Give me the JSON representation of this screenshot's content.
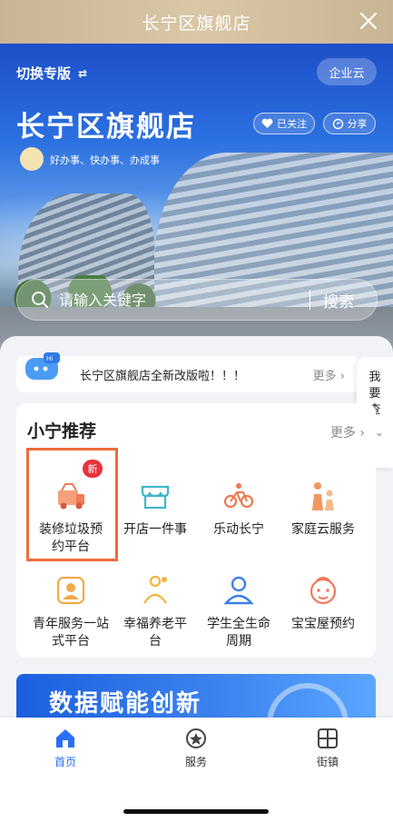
{
  "titlebar": {
    "title": "长宁区旗舰店"
  },
  "hero": {
    "switch_label": "切换专版",
    "enterprise_label": "企业云",
    "store_name": "长宁区旗舰店",
    "followed_label": "已关注",
    "share_label": "分享",
    "slogan": "好办事、快办事、办成事"
  },
  "search": {
    "placeholder": "请输入关键字",
    "button_label": "搜索"
  },
  "notice": {
    "text": "长宁区旗舰店全新改版啦！！！",
    "more_label": "更多",
    "hi_label": "Hi"
  },
  "side_tab": {
    "label": "我要查"
  },
  "recommend": {
    "title": "小宁推荐",
    "more_label": "更多",
    "new_badge": "新",
    "items": [
      {
        "label": "装修垃圾预约平台",
        "icon": "garbage-truck-icon"
      },
      {
        "label": "开店一件事",
        "icon": "shop-icon"
      },
      {
        "label": "乐动长宁",
        "icon": "bicycle-icon"
      },
      {
        "label": "家庭云服务",
        "icon": "family-icon"
      },
      {
        "label": "青年服务一站式平台",
        "icon": "youth-icon"
      },
      {
        "label": "幸福养老平台",
        "icon": "elderly-icon"
      },
      {
        "label": "学生全生命周期",
        "icon": "student-icon"
      },
      {
        "label": "宝宝屋预约",
        "icon": "baby-icon"
      }
    ]
  },
  "banner": {
    "text": "数据赋能创新"
  },
  "bottom_nav": [
    {
      "label": "首页",
      "icon": "home-icon",
      "active": true
    },
    {
      "label": "服务",
      "icon": "service-icon",
      "active": false
    },
    {
      "label": "街镇",
      "icon": "street-icon",
      "active": false
    }
  ],
  "colors": {
    "accent": "#2b6ff5",
    "highlight": "#ee6b3a",
    "badge": "#e8323c",
    "titlebar": "#cdb995"
  }
}
